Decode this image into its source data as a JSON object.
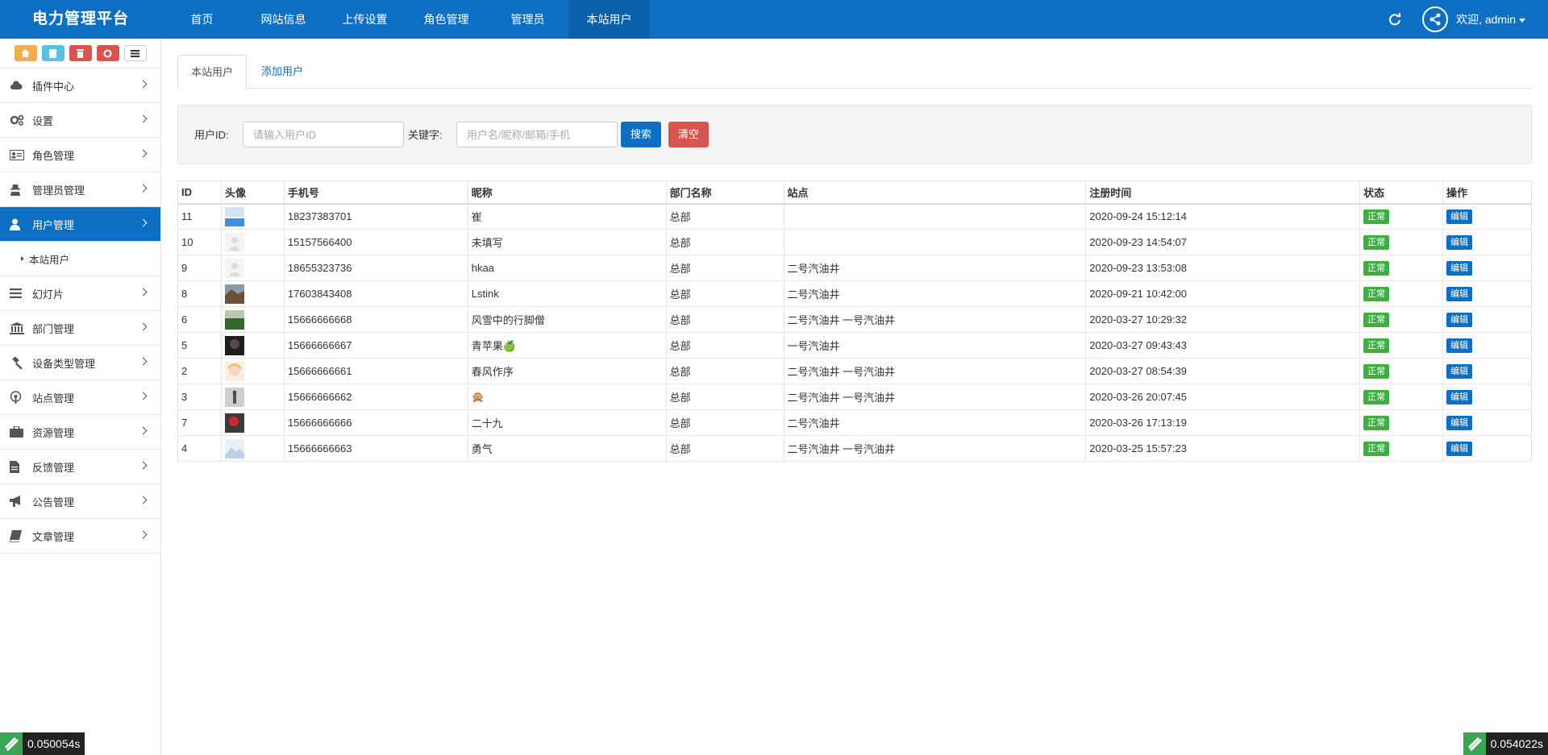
{
  "brand": "电力管理平台",
  "topnav": [
    "首页",
    "网站信息",
    "上传设置",
    "角色管理",
    "管理员",
    "本站用户"
  ],
  "topnav_active": 5,
  "user_menu": "欢迎, admin",
  "sidebar": {
    "menu": [
      {
        "label": "插件中心",
        "icon": "cloud-icon"
      },
      {
        "label": "设置",
        "icon": "gears-icon"
      },
      {
        "label": "角色管理",
        "icon": "id-card-icon"
      },
      {
        "label": "管理员管理",
        "icon": "user-secret-icon"
      },
      {
        "label": "用户管理",
        "icon": "user-icon",
        "active": true
      },
      {
        "label": "幻灯片",
        "icon": "list-icon"
      },
      {
        "label": "部门管理",
        "icon": "bank-icon"
      },
      {
        "label": "设备类型管理",
        "icon": "gavel-icon"
      },
      {
        "label": "站点管理",
        "icon": "podcast-icon"
      },
      {
        "label": "资源管理",
        "icon": "briefcase-icon"
      },
      {
        "label": "反馈管理",
        "icon": "file-icon"
      },
      {
        "label": "公告管理",
        "icon": "bullhorn-icon"
      },
      {
        "label": "文章管理",
        "icon": "book-icon"
      }
    ],
    "submenu": [
      "本站用户"
    ]
  },
  "tabs": {
    "active": "本站用户",
    "other": "添加用户"
  },
  "search": {
    "uid_label": "用户ID:",
    "uid_placeholder": "请输入用户ID",
    "kw_label": "关键字:",
    "kw_placeholder": "用户名/昵称/邮箱/手机",
    "search_btn": "搜索",
    "clear_btn": "清空"
  },
  "table": {
    "columns": [
      "ID",
      "头像",
      "手机号",
      "昵称",
      "部门名称",
      "站点",
      "注册时间",
      "状态",
      "操作"
    ],
    "rows": [
      {
        "id": "11",
        "avatar": "sky",
        "phone": "18237383701",
        "nick": "崔",
        "dept": "总部",
        "site": "",
        "time": "2020-09-24 15:12:14"
      },
      {
        "id": "10",
        "avatar": "default",
        "phone": "15157566400",
        "nick": "未填写",
        "dept": "总部",
        "site": "",
        "time": "2020-09-23 14:54:07"
      },
      {
        "id": "9",
        "avatar": "default",
        "phone": "18655323736",
        "nick": "hkaa",
        "dept": "总部",
        "site": "二号汽油井",
        "time": "2020-09-23 13:53:08"
      },
      {
        "id": "8",
        "avatar": "landscape",
        "phone": "17603843408",
        "nick": "Lstink",
        "dept": "总部",
        "site": "二号汽油井",
        "time": "2020-09-21 10:42:00"
      },
      {
        "id": "6",
        "avatar": "field",
        "phone": "15666666668",
        "nick": "风雪中的行脚僧",
        "dept": "总部",
        "site": "二号汽油井  一号汽油井",
        "time": "2020-03-27 10:29:32"
      },
      {
        "id": "5",
        "avatar": "dark",
        "phone": "15666666667",
        "nick": "青苹果🍏",
        "dept": "总部",
        "site": "一号汽油井",
        "time": "2020-03-27 09:43:43"
      },
      {
        "id": "2",
        "avatar": "anime",
        "phone": "15666666661",
        "nick": "春风作序",
        "dept": "总部",
        "site": "二号汽油井  一号汽油井",
        "time": "2020-03-27 08:54:39"
      },
      {
        "id": "3",
        "avatar": "figure",
        "phone": "15666666662",
        "nick": "🙊",
        "dept": "总部",
        "site": "二号汽油井  一号汽油井",
        "time": "2020-03-26 20:07:45"
      },
      {
        "id": "7",
        "avatar": "red",
        "phone": "15666666666",
        "nick": "二十九",
        "dept": "总部",
        "site": "二号汽油井",
        "time": "2020-03-26 17:13:19"
      },
      {
        "id": "4",
        "avatar": "snow",
        "phone": "15666666663",
        "nick": "勇气",
        "dept": "总部",
        "site": "二号汽油井  一号汽油井",
        "time": "2020-03-25 15:57:23"
      }
    ],
    "status_label": "正常",
    "edit_label": "编辑"
  },
  "timers": {
    "left": "0.050054s",
    "right": "0.054022s"
  },
  "colors": {
    "primary": "#0c6fc2",
    "success": "#3cb043",
    "danger": "#d9534f"
  }
}
